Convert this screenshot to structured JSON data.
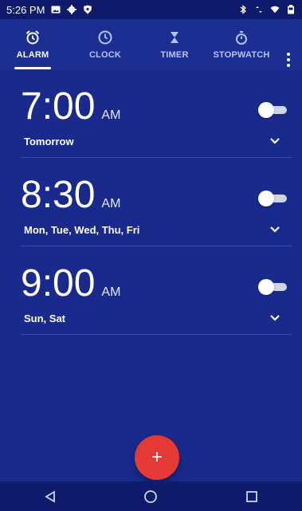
{
  "status_bar": {
    "time": "5:26 PM",
    "left_icons": [
      "photo-icon",
      "gear-icon",
      "shield-icon"
    ],
    "right_icons": [
      "bluetooth-icon",
      "data-arrows-icon",
      "wifi-icon",
      "battery-icon"
    ]
  },
  "tabs": [
    {
      "label": "ALARM",
      "icon": "alarm-clock-icon",
      "active": true
    },
    {
      "label": "CLOCK",
      "icon": "clock-icon",
      "active": false
    },
    {
      "label": "TIMER",
      "icon": "hourglass-icon",
      "active": false
    },
    {
      "label": "STOPWATCH",
      "icon": "stopwatch-icon",
      "active": false
    }
  ],
  "alarms": [
    {
      "time": "7:00",
      "ampm": "AM",
      "days": "Tomorrow",
      "enabled": false
    },
    {
      "time": "8:30",
      "ampm": "AM",
      "days": "Mon, Tue, Wed, Thu, Fri",
      "enabled": false
    },
    {
      "time": "9:00",
      "ampm": "AM",
      "days": "Sun, Sat",
      "enabled": false
    }
  ],
  "fab": {
    "label": "+"
  },
  "colors": {
    "background": "#1a2a8c",
    "fab": "#e53935",
    "statusbar": "#0e1a6b"
  }
}
